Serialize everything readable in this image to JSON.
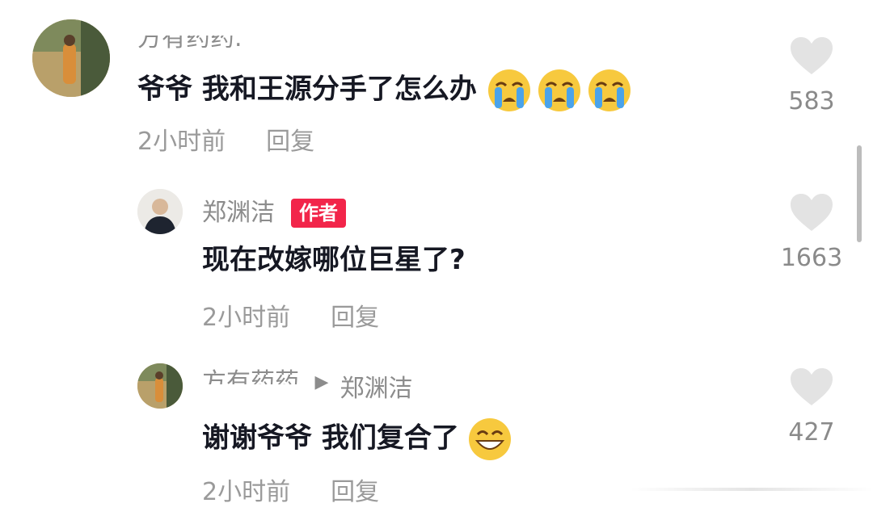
{
  "comments": [
    {
      "username": "方有药药.",
      "text": "爷爷 我和王源分手了怎么办",
      "emojis": [
        "crying-face",
        "crying-face",
        "crying-face"
      ],
      "time": "2小时前",
      "reply_label": "回复",
      "likes": "583"
    },
    {
      "username": "郑渊洁",
      "badge": "作者",
      "text": "现在改嫁哪位巨星了?",
      "time": "2小时前",
      "reply_label": "回复",
      "likes": "1663"
    },
    {
      "username": "方有药药.",
      "reply_to": "郑渊洁",
      "text": "谢谢爷爷 我们复合了",
      "emojis": [
        "grinning-face"
      ],
      "time": "2小时前",
      "reply_label": "回复",
      "likes": "427"
    }
  ],
  "colors": {
    "badge": "#f2254a",
    "heart": "#e3e3e3",
    "text": "#161823",
    "muted": "#9a9a9a"
  }
}
